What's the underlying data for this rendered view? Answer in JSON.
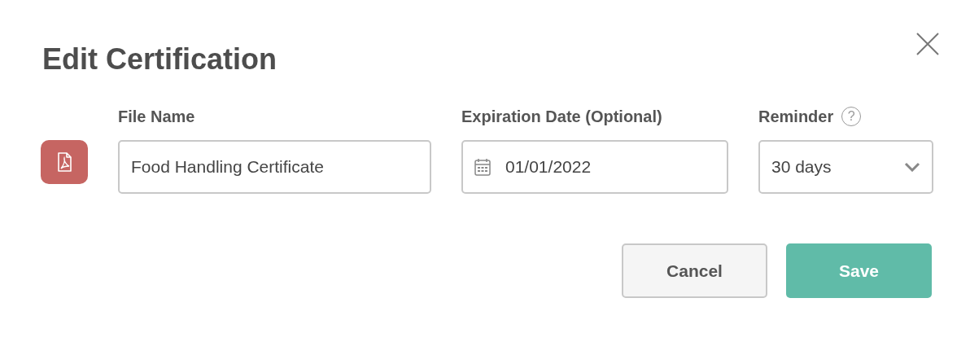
{
  "dialog": {
    "title": "Edit Certification"
  },
  "fields": [
    {
      "kind": "text",
      "label": "File Name",
      "value": "Food Handling Certificate"
    },
    {
      "kind": "date",
      "label": "Expiration Date (Optional)",
      "value": "01/01/2022"
    },
    {
      "kind": "select",
      "label": "Reminder",
      "help": "?",
      "value": "30 days"
    }
  ],
  "buttons": [
    {
      "kind": "secondary",
      "label": "Cancel"
    },
    {
      "kind": "primary",
      "label": "Save"
    }
  ]
}
